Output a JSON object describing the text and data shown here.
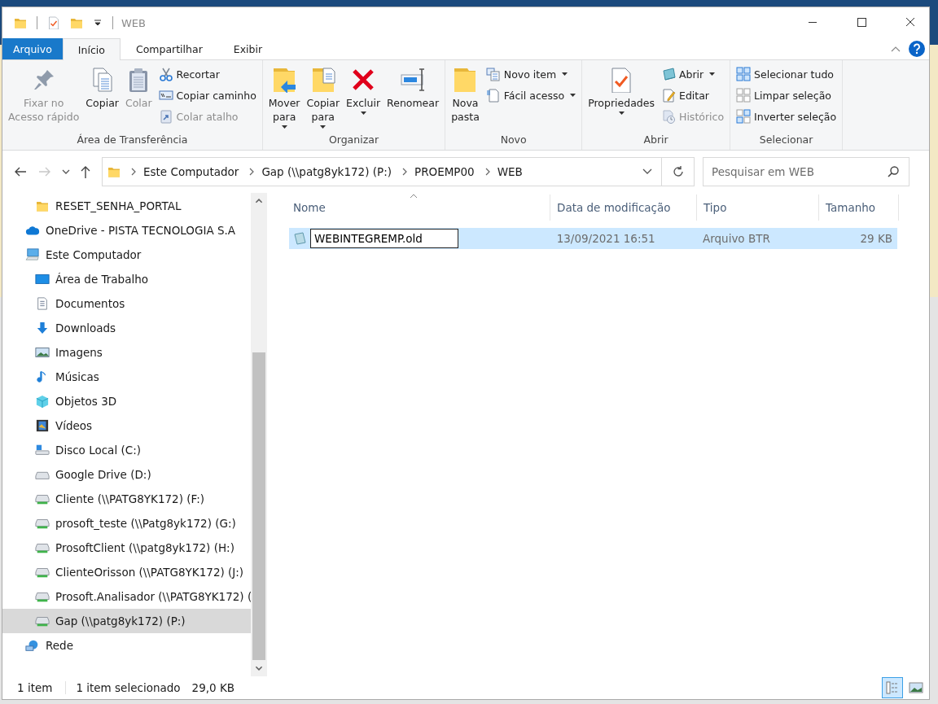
{
  "window": {
    "title": "WEB"
  },
  "ribbon_tabs": [
    {
      "label": "Arquivo",
      "kind": "file",
      "selected": false
    },
    {
      "label": "Início",
      "kind": "tab",
      "selected": true
    },
    {
      "label": "Compartilhar",
      "kind": "tab",
      "selected": false
    },
    {
      "label": "Exibir",
      "kind": "tab",
      "selected": false
    }
  ],
  "ribbon": {
    "groups": [
      {
        "label": "Área de Transferência",
        "items": [
          {
            "kind": "large",
            "label": "Fixar no\nAcesso rápido",
            "disabled": true
          },
          {
            "kind": "large",
            "label": "Copiar",
            "disabled": false
          },
          {
            "kind": "large",
            "label": "Colar",
            "disabled": true
          },
          {
            "kind": "small",
            "label": "Recortar",
            "disabled": false
          },
          {
            "kind": "small",
            "label": "Copiar caminho",
            "disabled": false
          },
          {
            "kind": "small",
            "label": "Colar atalho",
            "disabled": true
          }
        ]
      },
      {
        "label": "Organizar",
        "items": [
          {
            "kind": "large",
            "label": "Mover\npara",
            "disabled": false,
            "dropdown": true
          },
          {
            "kind": "large",
            "label": "Copiar\npara",
            "disabled": false,
            "dropdown": true
          },
          {
            "kind": "large",
            "label": "Excluir",
            "disabled": false,
            "dropdown": true
          },
          {
            "kind": "large",
            "label": "Renomear",
            "disabled": false
          }
        ]
      },
      {
        "label": "Novo",
        "items": [
          {
            "kind": "large",
            "label": "Nova\npasta",
            "disabled": false
          },
          {
            "kind": "small",
            "label": "Novo item",
            "disabled": false,
            "dropdown": true
          },
          {
            "kind": "small",
            "label": "Fácil acesso",
            "disabled": false,
            "dropdown": true
          }
        ]
      },
      {
        "label": "Abrir",
        "items": [
          {
            "kind": "large",
            "label": "Propriedades",
            "disabled": false,
            "dropdown": true
          },
          {
            "kind": "small",
            "label": "Abrir",
            "disabled": false,
            "dropdown": true
          },
          {
            "kind": "small",
            "label": "Editar",
            "disabled": false
          },
          {
            "kind": "small",
            "label": "Histórico",
            "disabled": true
          }
        ]
      },
      {
        "label": "Selecionar",
        "items": [
          {
            "kind": "small",
            "label": "Selecionar tudo",
            "disabled": false
          },
          {
            "kind": "small",
            "label": "Limpar seleção",
            "disabled": false
          },
          {
            "kind": "small",
            "label": "Inverter seleção",
            "disabled": false
          }
        ]
      }
    ]
  },
  "address_bar": {
    "back_disabled": false,
    "forward_disabled": true,
    "segments": [
      "Este Computador",
      "Gap (\\\\patg8yk172) (P:)",
      "PROEMP00",
      "WEB"
    ]
  },
  "search": {
    "placeholder": "Pesquisar em WEB"
  },
  "sidebar": {
    "items": [
      {
        "label": "RESET_SENHA_PORTAL",
        "kind": "folder",
        "selected": false,
        "nested": true
      },
      {
        "label": "OneDrive - PISTA TECNOLOGIA S.A",
        "kind": "cloud",
        "selected": false
      },
      {
        "label": "Este Computador",
        "kind": "computer",
        "selected": false,
        "children": [
          {
            "label": "Área de Trabalho",
            "kind": "desktop",
            "selected": false
          },
          {
            "label": "Documentos",
            "kind": "documents",
            "selected": false
          },
          {
            "label": "Downloads",
            "kind": "downloads",
            "selected": false
          },
          {
            "label": "Imagens",
            "kind": "pictures",
            "selected": false
          },
          {
            "label": "Músicas",
            "kind": "music",
            "selected": false
          },
          {
            "label": "Objetos 3D",
            "kind": "objects",
            "selected": false
          },
          {
            "label": "Vídeos",
            "kind": "videos",
            "selected": false
          },
          {
            "label": "Disco Local (C:)",
            "kind": "localdisk",
            "selected": false
          },
          {
            "label": "Google Drive (D:)",
            "kind": "drive",
            "selected": false
          },
          {
            "label": "Cliente (\\\\PATG8YK172) (F:)",
            "kind": "netdrive",
            "selected": false
          },
          {
            "label": "prosoft_teste (\\\\Patg8yk172) (G:)",
            "kind": "netdrive",
            "selected": false
          },
          {
            "label": "ProsoftClient (\\\\patg8yk172) (H:)",
            "kind": "netdrive",
            "selected": false
          },
          {
            "label": "ClienteOrisson (\\\\PATG8YK172) (J:)",
            "kind": "netdrive",
            "selected": false
          },
          {
            "label": "Prosoft.Analisador (\\\\PATG8YK172) (",
            "kind": "netdrive",
            "selected": false
          },
          {
            "label": "Gap (\\\\patg8yk172) (P:)",
            "kind": "netdrive",
            "selected": true
          }
        ]
      },
      {
        "label": "Rede",
        "kind": "network",
        "selected": false
      }
    ]
  },
  "file_list": {
    "columns": [
      {
        "label": "Nome",
        "sorted": true
      },
      {
        "label": "Data de modificação",
        "sorted": false
      },
      {
        "label": "Tipo",
        "sorted": false
      },
      {
        "label": "Tamanho",
        "sorted": false
      }
    ],
    "rows": [
      {
        "name": "WEBINTEGREMP.old",
        "renaming": true,
        "selected": true,
        "date": "13/09/2021 16:51",
        "type": "Arquivo BTR",
        "size": "29 KB"
      }
    ]
  },
  "status_bar": {
    "item_count": "1 item",
    "selection": "1 item selecionado",
    "selection_size": "29,0 KB",
    "views": [
      {
        "kind": "details",
        "selected": true
      },
      {
        "kind": "large-icons",
        "selected": false
      }
    ]
  }
}
